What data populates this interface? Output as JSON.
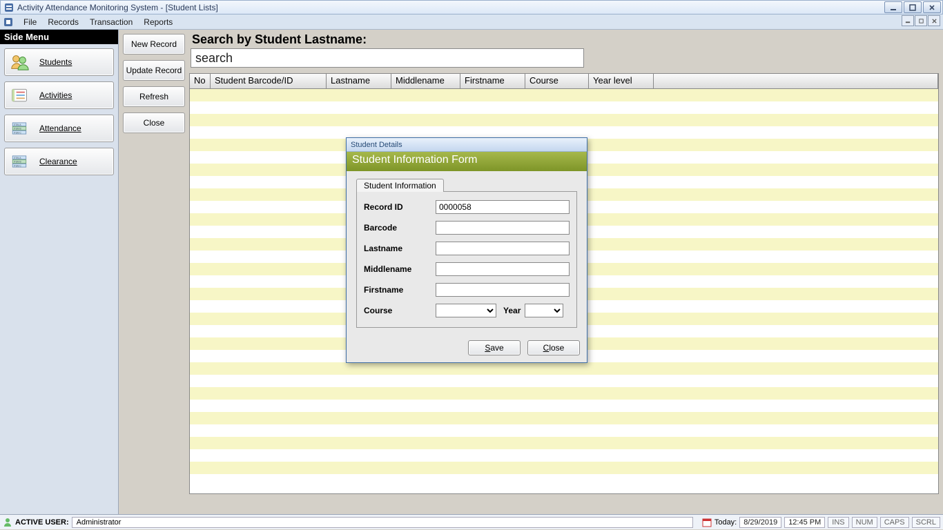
{
  "title": "Activity Attendance Monitoring System - [Student Lists]",
  "menu": {
    "file": "File",
    "records": "Records",
    "transaction": "Transaction",
    "reports": "Reports"
  },
  "side": {
    "header": "Side Menu",
    "items": [
      {
        "label": "Students"
      },
      {
        "label": "Activities"
      },
      {
        "label": "Attendance"
      },
      {
        "label": "Clearance"
      }
    ]
  },
  "toolbar": {
    "new_record": "New Record",
    "update_record": "Update Record",
    "refresh": "Refresh",
    "close": "Close"
  },
  "search": {
    "label": "Search by Student Lastname:",
    "value": "search"
  },
  "grid": {
    "columns": [
      "No",
      "Student Barcode/ID",
      "Lastname",
      "Middlename",
      "Firstname",
      "Course",
      "Year level"
    ]
  },
  "dialog": {
    "title": "Student Details",
    "banner": "Student Information Form",
    "tab": "Student Information",
    "fields": {
      "record_id_label": "Record ID",
      "record_id_value": "0000058",
      "barcode_label": "Barcode",
      "barcode_value": "",
      "lastname_label": "Lastname",
      "lastname_value": "",
      "middlename_label": "Middlename",
      "middlename_value": "",
      "firstname_label": "Firstname",
      "firstname_value": "",
      "course_label": "Course",
      "year_label": "Year"
    },
    "buttons": {
      "save": "Save",
      "close": "Close"
    }
  },
  "status": {
    "active_user_label": "ACTIVE USER:",
    "active_user": "Administrator",
    "today_label": "Today:",
    "date": "8/29/2019",
    "time": "12:45 PM",
    "ins": "INS",
    "num": "NUM",
    "caps": "CAPS",
    "scrl": "SCRL"
  }
}
